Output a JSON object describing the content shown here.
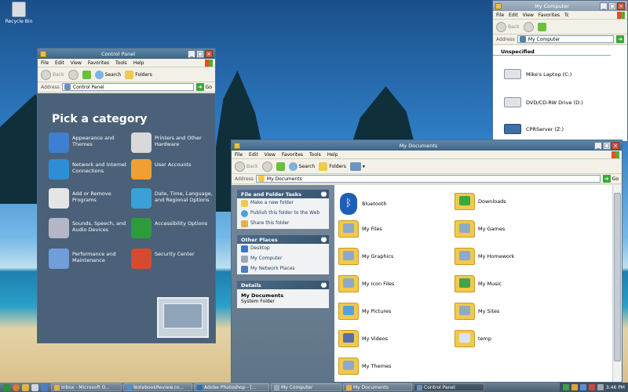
{
  "desktop": {
    "recycle_bin": "Recycle Bin"
  },
  "menus": [
    "File",
    "Edit",
    "View",
    "Favorites",
    "Tools",
    "Help"
  ],
  "toolbar": {
    "back": "Back",
    "search": "Search",
    "folders": "Folders"
  },
  "address_label": "Address",
  "go_label": "Go",
  "control_panel": {
    "title": "Control Panel",
    "address": "Control Panel",
    "heading": "Pick a category",
    "categories": [
      {
        "label": "Appearance and Themes",
        "icon": "appearance-icon",
        "color": "#3f7fcf"
      },
      {
        "label": "Printers and Other Hardware",
        "icon": "printer-icon",
        "color": "#d9d9d9"
      },
      {
        "label": "Network and Internet Connections",
        "icon": "network-icon",
        "color": "#2c8fd6"
      },
      {
        "label": "User Accounts",
        "icon": "user-accounts-icon",
        "color": "#f0a030"
      },
      {
        "label": "Add or Remove Programs",
        "icon": "add-remove-programs-icon",
        "color": "#e5e5e5"
      },
      {
        "label": "Date, Time, Language, and Regional Options",
        "icon": "date-time-icon",
        "color": "#3aa0d8"
      },
      {
        "label": "Sounds, Speech, and Audio Devices",
        "icon": "sounds-icon",
        "color": "#b5b5c8"
      },
      {
        "label": "Accessibility Options",
        "icon": "accessibility-icon",
        "color": "#2e9c3a"
      },
      {
        "label": "Performance and Maintenance",
        "icon": "performance-icon",
        "color": "#6f9ed8"
      },
      {
        "label": "Security Center",
        "icon": "shield-icon",
        "color": "#d64b2f"
      }
    ]
  },
  "my_computer": {
    "title": "My Computer",
    "address": "My Computer",
    "section": "Unspecified",
    "drives": [
      "Mike's Laptop (C:)",
      "DVD/CD-RW Drive (D:)",
      "CPRServer (Z:)"
    ]
  },
  "my_documents": {
    "title": "My Documents",
    "address": "My Documents",
    "tasks_panel": {
      "title": "File and Folder Tasks",
      "items": [
        "Make a new folder",
        "Publish this folder to the Web",
        "Share this folder"
      ]
    },
    "places_panel": {
      "title": "Other Places",
      "items": [
        "Desktop",
        "My Computer",
        "My Network Places"
      ]
    },
    "details_panel": {
      "title": "Details",
      "name": "My Documents",
      "type": "System Folder"
    },
    "files": [
      {
        "label": "Bluetooth",
        "kind": "bluetooth-icon"
      },
      {
        "label": "Downloads",
        "kind": "downloads-folder-icon"
      },
      {
        "label": "My Files",
        "kind": "folder-icon"
      },
      {
        "label": "My Games",
        "kind": "folder-icon"
      },
      {
        "label": "My Graphics",
        "kind": "folder-icon"
      },
      {
        "label": "My Homework",
        "kind": "folder-icon"
      },
      {
        "label": "My Icon Files",
        "kind": "folder-icon"
      },
      {
        "label": "My Music",
        "kind": "music-folder-icon"
      },
      {
        "label": "My Pictures",
        "kind": "pictures-folder-icon"
      },
      {
        "label": "My Sites",
        "kind": "folder-icon"
      },
      {
        "label": "My Videos",
        "kind": "videos-folder-icon"
      },
      {
        "label": "temp",
        "kind": "clock-folder-icon"
      },
      {
        "label": "My Themes",
        "kind": "folder-icon"
      }
    ]
  },
  "taskbar": {
    "tasks": [
      "Inbox - Microsoft O...",
      "NotebookReview.co...",
      "Adobe Photoshop - [...",
      "My Computer",
      "My Documents",
      "Control Panel"
    ],
    "clock": "3:46 PM"
  },
  "colors": {
    "titlebar": "#4f7597",
    "cp_background": "#4a6179",
    "folder": "#f2c94c"
  }
}
